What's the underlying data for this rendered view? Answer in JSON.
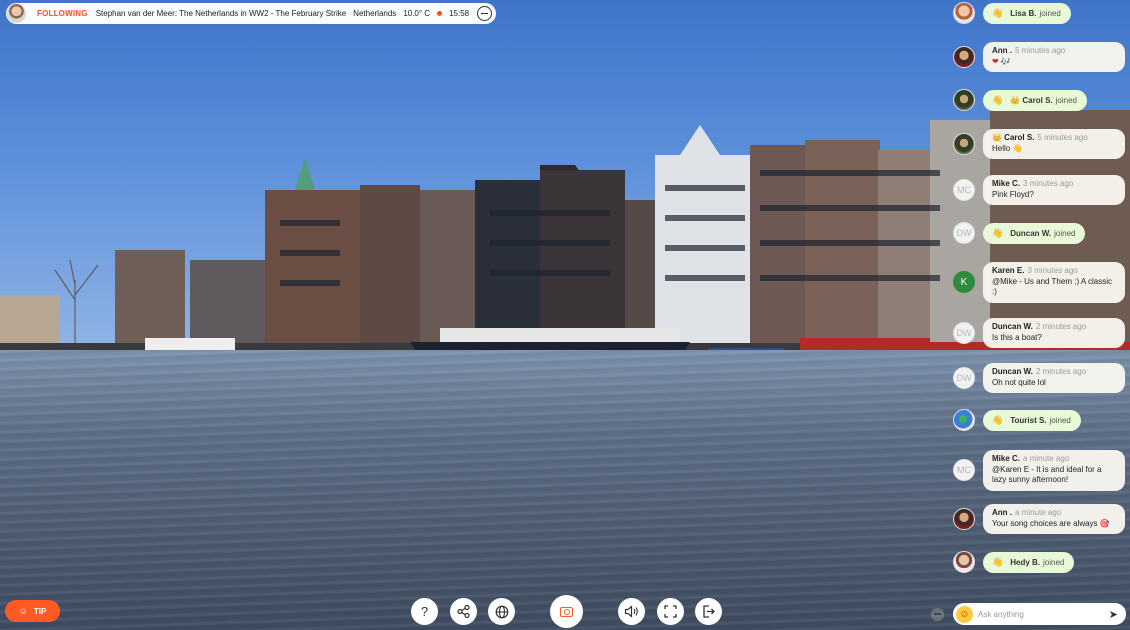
{
  "stream": {
    "following_label": "FOLLOWING",
    "host_title": "Stephan van der Meer: The Netherlands in WW2 - The February Strike",
    "location": "Netherlands",
    "temperature": "10.0° C",
    "time": "15:58",
    "live_dot_color": "#ff4d1c",
    "exit_icon": "minus-circle-icon"
  },
  "chat": {
    "messages": [
      {
        "type": "join",
        "name": "Lisa B.",
        "text": "joined",
        "avatar": "photo"
      },
      {
        "type": "message",
        "name": "Ann .",
        "ago": "5 minutes ago",
        "text": "❤ 🎶",
        "avatar": "photo"
      },
      {
        "type": "join",
        "name": "👑 Carol S.",
        "text": "joined",
        "avatar": "photo"
      },
      {
        "type": "message",
        "name": "👑 Carol S.",
        "ago": "5 minutes ago",
        "text": "Hello 👋",
        "avatar": "photo"
      },
      {
        "type": "message",
        "name": "Mike C.",
        "ago": "3 minutes ago",
        "text": "Pink Floyd?",
        "avatar": "MC"
      },
      {
        "type": "join",
        "name": "Duncan W.",
        "text": "joined",
        "avatar": "DW"
      },
      {
        "type": "message",
        "name": "Karen E.",
        "ago": "3 minutes ago",
        "text": "@Mike - Us and Them :) A classic :)",
        "avatar": "K"
      },
      {
        "type": "message",
        "name": "Duncan W.",
        "ago": "2 minutes ago",
        "text": "Is this a boat?",
        "avatar": "DW"
      },
      {
        "type": "message",
        "name": "Duncan W.",
        "ago": "2 minutes ago",
        "text": "Oh not quite lol",
        "avatar": "DW"
      },
      {
        "type": "join",
        "name": "Tourist S.",
        "text": "joined",
        "avatar": "globe"
      },
      {
        "type": "message",
        "name": "Mike C.",
        "ago": "a minute ago",
        "text": "@Karen E - It is and ideal for a lazy sunny afternoon!",
        "avatar": "MC"
      },
      {
        "type": "message",
        "name": "Ann .",
        "ago": "a minute ago",
        "text": "Your song choices are always 🎯",
        "avatar": "photo"
      },
      {
        "type": "join",
        "name": "Hedy B.",
        "text": "joined",
        "avatar": "photo"
      }
    ],
    "ask_placeholder": "Ask anything",
    "emoji_icon": "smiley-icon",
    "send_icon": "send-icon"
  },
  "controls": {
    "tip_label": "TIP",
    "tip_color": "#ff5a23",
    "buttons": [
      "help-icon",
      "share-icon",
      "globe-icon",
      "camera-icon",
      "volume-icon",
      "fullscreen-icon",
      "exit-icon"
    ]
  }
}
